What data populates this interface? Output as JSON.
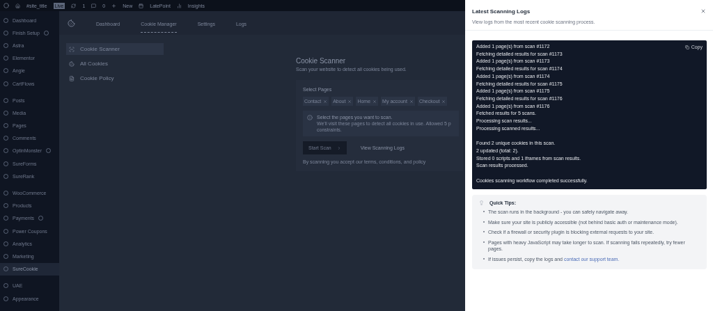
{
  "admin_bar": {
    "site_title": "#site_title",
    "live_badge": "Live",
    "updates": "1",
    "comments": "0",
    "new": "New",
    "items": [
      "LatePoint",
      "Insights"
    ]
  },
  "sidebar": {
    "items": [
      {
        "label": "Dashboard",
        "badge": false,
        "selected": false
      },
      {
        "label": "Finish Setup",
        "badge": true,
        "selected": false
      },
      {
        "label": "Astra",
        "badge": false,
        "selected": false
      },
      {
        "label": "Elementor",
        "badge": false,
        "selected": false
      },
      {
        "label": "Angie",
        "badge": false,
        "selected": false
      },
      {
        "label": "CartFlows",
        "badge": false,
        "selected": false
      },
      {
        "label": "Posts",
        "badge": false,
        "selected": false
      },
      {
        "label": "Media",
        "badge": false,
        "selected": false
      },
      {
        "label": "Pages",
        "badge": false,
        "selected": false
      },
      {
        "label": "Comments",
        "badge": false,
        "selected": false
      },
      {
        "label": "OptinMonster",
        "badge": true,
        "selected": false
      },
      {
        "label": "SureForms",
        "badge": false,
        "selected": false
      },
      {
        "label": "SureRank",
        "badge": false,
        "selected": false
      },
      {
        "label": "WooCommerce",
        "badge": false,
        "selected": false
      },
      {
        "label": "Products",
        "badge": false,
        "selected": false
      },
      {
        "label": "Payments",
        "badge": true,
        "selected": false
      },
      {
        "label": "Power Coupons",
        "badge": false,
        "selected": false
      },
      {
        "label": "Analytics",
        "badge": false,
        "selected": false
      },
      {
        "label": "Marketing",
        "badge": false,
        "selected": false
      },
      {
        "label": "SureCookie",
        "badge": false,
        "selected": true
      },
      {
        "label": "UAE",
        "badge": false,
        "selected": false
      },
      {
        "label": "Appearance",
        "badge": false,
        "selected": false
      }
    ]
  },
  "plugin_tabs": [
    {
      "label": "Dashboard",
      "selected": false
    },
    {
      "label": "Cookie Manager",
      "selected": true
    },
    {
      "label": "Settings",
      "selected": false
    },
    {
      "label": "Logs",
      "selected": false
    }
  ],
  "side_menu": [
    {
      "label": "Cookie Scanner",
      "selected": true
    },
    {
      "label": "All Cookies",
      "selected": false
    },
    {
      "label": "Cookie Policy",
      "selected": false
    }
  ],
  "scanner": {
    "title": "Cookie Scanner",
    "subtitle": "Scan your website to detect all cookies being used.",
    "select_label": "Select Pages",
    "pages": [
      "Contact",
      "About",
      "Home",
      "My account",
      "Checkout"
    ],
    "info_title": "Select the pages you want to scan.",
    "info_text": "We'll visit these pages to detect all cookies in use. Allowed 5 p",
    "info_text_2": "constraints.",
    "start_button": "Start Scan",
    "logs_button": "View Scanning Logs",
    "terms": "By scanning you accept our terms, conditions, and policy"
  },
  "drawer": {
    "title": "Latest Scanning Logs",
    "subtitle": "View logs from the most recent cookie scanning process.",
    "copy": "Copy",
    "log_groups": [
      [
        "Added 1 page(s) from scan #1172",
        "Fetching detailed results for scan #1173",
        "Added 1 page(s) from scan #1173",
        "Fetching detailed results for scan #1174",
        "Added 1 page(s) from scan #1174",
        "Fetching detailed results for scan #1175",
        "Added 1 page(s) from scan #1175",
        "Fetching detailed results for scan #1176",
        "Added 1 page(s) from scan #1176",
        "Fetched results for 5 scans.",
        "Processing scan results...",
        "Processing scanned results..."
      ],
      [
        "Found 2 unique cookies in this scan.",
        "2 updated (total: 2).",
        "Stored 0 scripts and 1 iframes from scan results.",
        "Scan results processed."
      ],
      [
        "Cookies scanning workflow completed successfully."
      ]
    ],
    "tips_title": "Quick Tips:",
    "tips": [
      {
        "text": "The scan runs in the background - you can safely navigate away."
      },
      {
        "text": "Make sure your site is publicly accessible (not behind basic auth or maintenance mode)."
      },
      {
        "text": "Check if a firewall or security plugin is blocking external requests to your site."
      },
      {
        "text": "Pages with heavy JavaScript may take longer to scan. If scanning fails repeatedly, try fewer pages."
      },
      {
        "text": "If issues persist, copy the logs and",
        "link": "contact our support team."
      }
    ]
  }
}
